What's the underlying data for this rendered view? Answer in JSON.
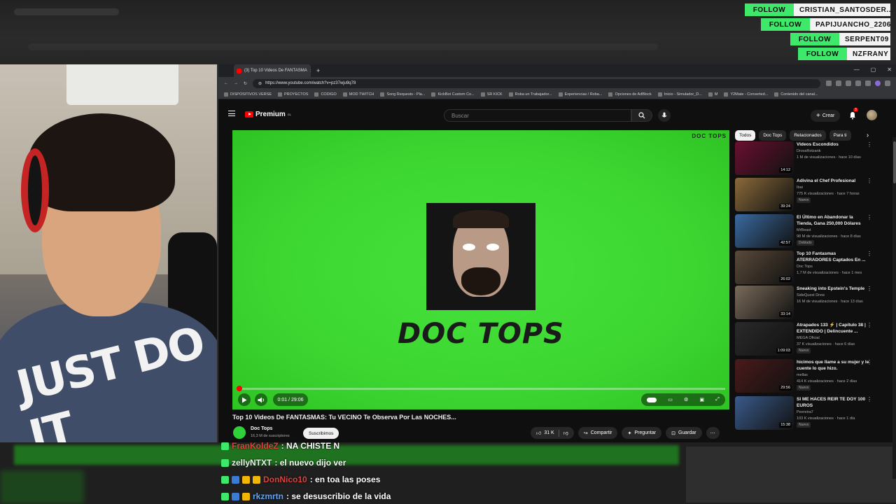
{
  "follows": [
    {
      "label": "FOLLOW",
      "user": "CRISTIAN_SANTOSDER..."
    },
    {
      "label": "FOLLOW",
      "user": "PAPIJUANCHO_2206"
    },
    {
      "label": "FOLLOW",
      "user": "SERPENT09"
    },
    {
      "label": "FOLLOW",
      "user": "NZFRANY"
    }
  ],
  "browser": {
    "tab_title": "(3) Top 10 Videos De FANTASMA",
    "url": "https://www.youtube.com/watch?v=pz37wju9q78",
    "bookmarks": [
      "DISPOSITIVOS VERSE",
      "PROYECTOS",
      "CODIGO",
      "MOD TWITCH",
      "Song Requests - Pla...",
      "KickBot Custom Co...",
      "SR KICK",
      "Roba un Trabajador...",
      "Experiencias / Roba...",
      "Opciones de AdBlock",
      "Inicio - Simulador_D...",
      "M",
      "Y2Mate - Converted...",
      "Contenido del canal..."
    ]
  },
  "youtube": {
    "logo": "Premium",
    "logo_sup": "CL",
    "search_placeholder": "Buscar",
    "create_label": "Crear",
    "notification_count": "3",
    "player": {
      "watermark": "DOC TOPS",
      "title_art": "DOC TOPS",
      "time": "0:01 / 29:06",
      "progress": 0.0006
    },
    "video": {
      "title": "Top 10 Videos De FANTASMAS: Tu VECINO Te Observa Por Las NOCHES...",
      "channel": "Doc Tops",
      "subs": "16,3 M de suscriptores",
      "subscribed_label": "Suscribimos",
      "likes": "31 K",
      "share": "Compartir",
      "ask": "Preguntar",
      "save": "Guardar"
    },
    "chips": [
      "Todos",
      "Doc Tops",
      "Relacionados",
      "Para ti"
    ],
    "recommendations": [
      {
        "title": "Videos Escondidos",
        "channel": "DrossRotzank",
        "meta": "1 M de visualizaciones · hace 10 días",
        "duration": "14:12",
        "badge": "",
        "thumb": "#6a1030"
      },
      {
        "title": "Adivina el Chef Profesional",
        "channel": "Ibai",
        "meta": "775 K visualizaciones · hace 7 horas",
        "duration": "39:24",
        "badge": "Nuevo",
        "thumb": "#8a6a3a"
      },
      {
        "title": "El Último en Abandonar la Tienda, Gana 250,000 Dólares",
        "channel": "MrBeast",
        "meta": "98 M de visualizaciones · hace 8 días",
        "duration": "42:57",
        "badge": "Doblado",
        "thumb": "#3a6aa0"
      },
      {
        "title": "Top 10 Fantasmas ATERRADORES Captados En ...",
        "channel": "Doc Tops",
        "meta": "1,7 M de visualizaciones · hace 1 mes",
        "duration": "26:02",
        "badge": "",
        "thumb": "#5a4a3a"
      },
      {
        "title": "Sneaking into Epstein's Temple",
        "channel": "SideQuest Drew",
        "meta": "16 M de visualizaciones · hace 13 días",
        "duration": "33:14",
        "badge": "",
        "thumb": "#7a6a5a"
      },
      {
        "title": "Atrapados 133 ⚡ | Capítulo 38 | EXTENDIDO | Delincuente ...",
        "channel": "MEGA Oficial",
        "meta": "37 K visualizaciones · hace 6 días",
        "duration": "1:09:03",
        "badge": "Nuevo",
        "thumb": "#2a2a2a"
      },
      {
        "title": "hicimos que llame a su mujer y le cuente lo que hizo.",
        "channel": "mellas",
        "meta": "414 K visualizaciones · hace 2 días",
        "duration": "29:56",
        "badge": "Nuevo",
        "thumb": "#4a1a1a"
      },
      {
        "title": "SI ME HACES REIR TE DOY 100 EUROS",
        "channel": "Peereira7",
        "meta": "103 K visualizaciones · hace 1 día",
        "duration": "15:38",
        "badge": "Nuevo",
        "thumb": "#3a5a8a"
      }
    ]
  },
  "chat": [
    {
      "user": "FranKoldeZ",
      "user_color": "#e0413d",
      "message": ": NA CHISTE N",
      "badges": [
        "#3ee86a"
      ]
    },
    {
      "user": "zellyNTXT",
      "user_color": "#f1f1f1",
      "message": ": el nuevo dijo ver",
      "badges": [
        "#3ee86a"
      ]
    },
    {
      "user": "DonNico10",
      "user_color": "#e0413d",
      "message": ": en toa las poses",
      "badges": [
        "#3ee86a",
        "#3a7bd5",
        "#f2b705",
        "#f2b705"
      ]
    },
    {
      "user": "rkzmrtn",
      "user_color": "#5aa6ff",
      "message": ": se desuscribio de la vida",
      "badges": [
        "#3ee86a",
        "#3a7bd5",
        "#f2b705"
      ]
    }
  ],
  "webcam": {
    "shirt_logo": "JUST DO IT"
  }
}
